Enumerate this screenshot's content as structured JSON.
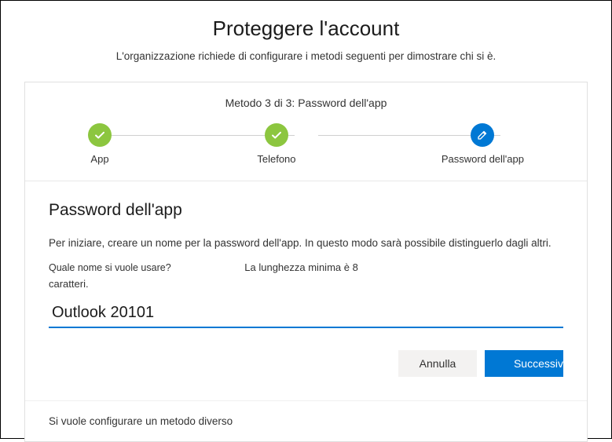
{
  "header": {
    "title": "Proteggere l'account",
    "subtitle": "L'organizzazione richiede di configurare i metodi seguenti per dimostrare chi si è."
  },
  "stepper": {
    "caption": "Metodo 3 di 3: Password dell'app",
    "steps": [
      {
        "label": "App",
        "state": "done"
      },
      {
        "label": "Telefono",
        "state": "done"
      },
      {
        "label": "Password dell'app",
        "state": "active"
      }
    ]
  },
  "section": {
    "title": "Password dell'app",
    "instruction": "Per iniziare, creare un nome per la password dell'app. In questo modo sarà possibile distinguerlo dagli altri.",
    "hint_question": "Quale nome si vuole usare?",
    "hint_length": "La lunghezza minima è 8",
    "hint_suffix": "caratteri.",
    "input_value": "Outlook 20101"
  },
  "buttons": {
    "cancel": "Annulla",
    "next": "Successiv"
  },
  "footer": {
    "alt_method": "Si vuole configurare un metodo diverso"
  }
}
